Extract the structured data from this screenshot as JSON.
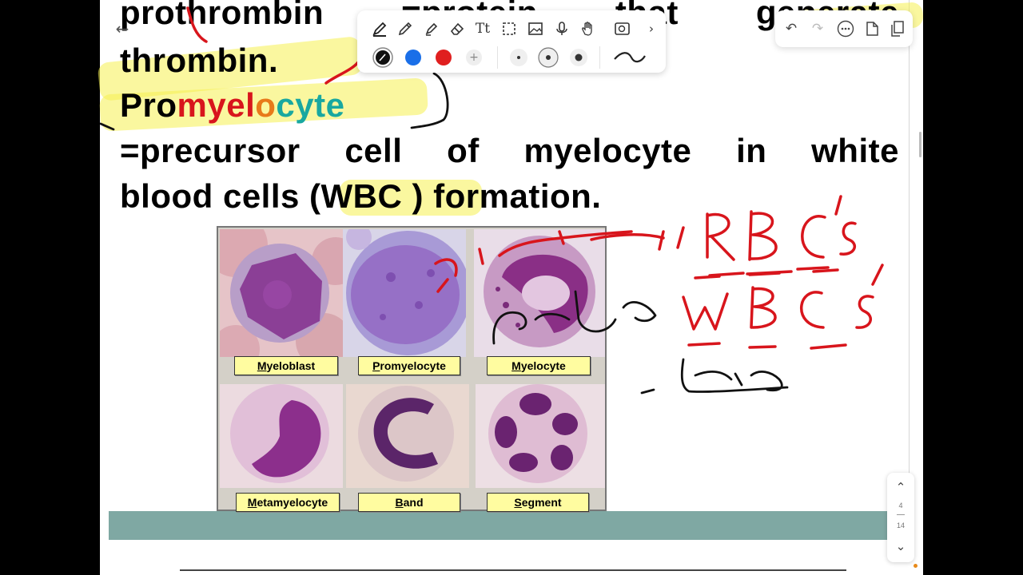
{
  "document": {
    "line1": [
      "prothrombin",
      "=protein",
      "that",
      "generate"
    ],
    "line2": "thrombin.",
    "line3": [
      {
        "text": "Pro",
        "color": "#000000"
      },
      {
        "text": "myel",
        "color": "#d8151c"
      },
      {
        "text": "o",
        "color": "#e87a1a"
      },
      {
        "text": "cyte",
        "color": "#19a8a0"
      }
    ],
    "line4": [
      "=precursor",
      "cell",
      "of",
      "myelocyte",
      "in",
      "white"
    ],
    "line5": "blood cells (WBC ) formation."
  },
  "figure": {
    "labels": [
      "Myeloblast",
      "Promyelocyte",
      "Myelocyte",
      "Metamyelocyte",
      "Band",
      "Segment"
    ]
  },
  "annotations": {
    "handwriting": [
      "RBC's",
      "WBC's"
    ],
    "ink_color": "#d8151c"
  },
  "toolbar": {
    "tools": [
      "pen-tool-icon",
      "pencil-icon",
      "highlighter-icon",
      "eraser-icon",
      "text-tool-icon",
      "lasso-select-icon",
      "image-icon",
      "microphone-icon",
      "hand-icon",
      "shape-recognition-icon"
    ],
    "colors": [
      "#111111",
      "#1a6fe8",
      "#e01f1f"
    ],
    "add_color": "+",
    "selected_color": "#111111"
  },
  "top_right": {
    "icons": [
      "undo-icon",
      "redo-icon",
      "more-icon",
      "export-icon",
      "pages-icon"
    ]
  },
  "pager": {
    "current_page": "4",
    "total_pages": "14"
  }
}
